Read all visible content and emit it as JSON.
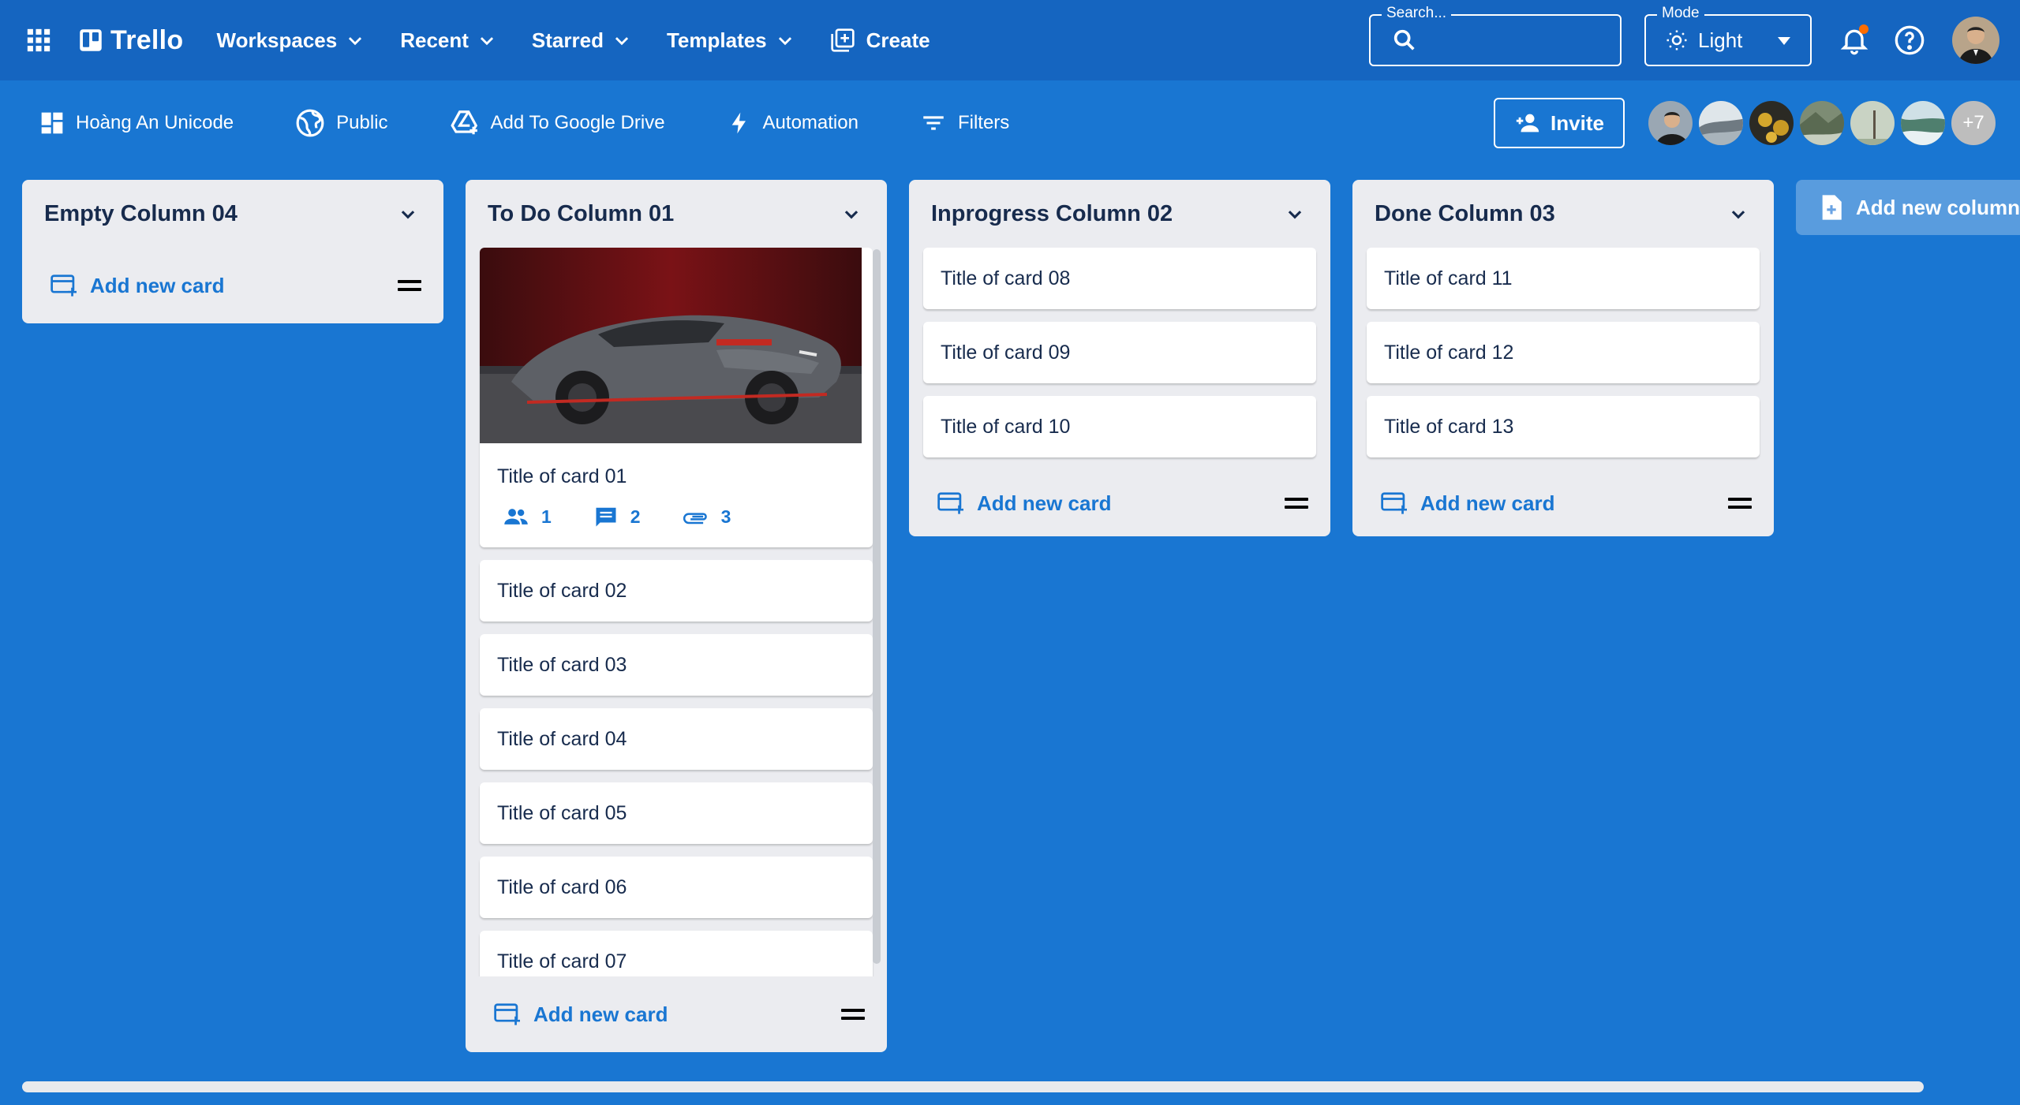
{
  "appbar": {
    "brand": "Trello",
    "menus": [
      {
        "label": "Workspaces"
      },
      {
        "label": "Recent"
      },
      {
        "label": "Starred"
      },
      {
        "label": "Templates"
      }
    ],
    "create_label": "Create",
    "search": {
      "legend": "Search...",
      "value": ""
    },
    "mode": {
      "legend": "Mode",
      "value": "Light"
    }
  },
  "boardbar": {
    "board_name": "Hoàng An Unicode",
    "visibility": "Public",
    "drive": "Add To Google Drive",
    "automation": "Automation",
    "filters": "Filters",
    "invite": "Invite",
    "extra_members": "+7"
  },
  "columns": [
    {
      "title": "Empty Column 04",
      "cards": [],
      "add_label": "Add new card"
    },
    {
      "title": "To Do Column 01",
      "cards": [
        {
          "title": "Title of card 01",
          "members": "1",
          "comments": "2",
          "attachments": "3"
        },
        {
          "title": "Title of card 02"
        },
        {
          "title": "Title of card 03"
        },
        {
          "title": "Title of card 04"
        },
        {
          "title": "Title of card 05"
        },
        {
          "title": "Title of card 06"
        },
        {
          "title": "Title of card 07"
        }
      ],
      "add_label": "Add new card"
    },
    {
      "title": "Inprogress Column 02",
      "cards": [
        {
          "title": "Title of card 08"
        },
        {
          "title": "Title of card 09"
        },
        {
          "title": "Title of card 10"
        }
      ],
      "add_label": "Add new card"
    },
    {
      "title": "Done Column 03",
      "cards": [
        {
          "title": "Title of card 11"
        },
        {
          "title": "Title of card 12"
        },
        {
          "title": "Title of card 13"
        }
      ],
      "add_label": "Add new card"
    }
  ],
  "add_column_label": "Add new column",
  "colors": {
    "appbar": "#1565c0",
    "board": "#1976d2",
    "column": "#ebecf0",
    "accent": "#1976d2",
    "notification": "#ff6d00"
  }
}
